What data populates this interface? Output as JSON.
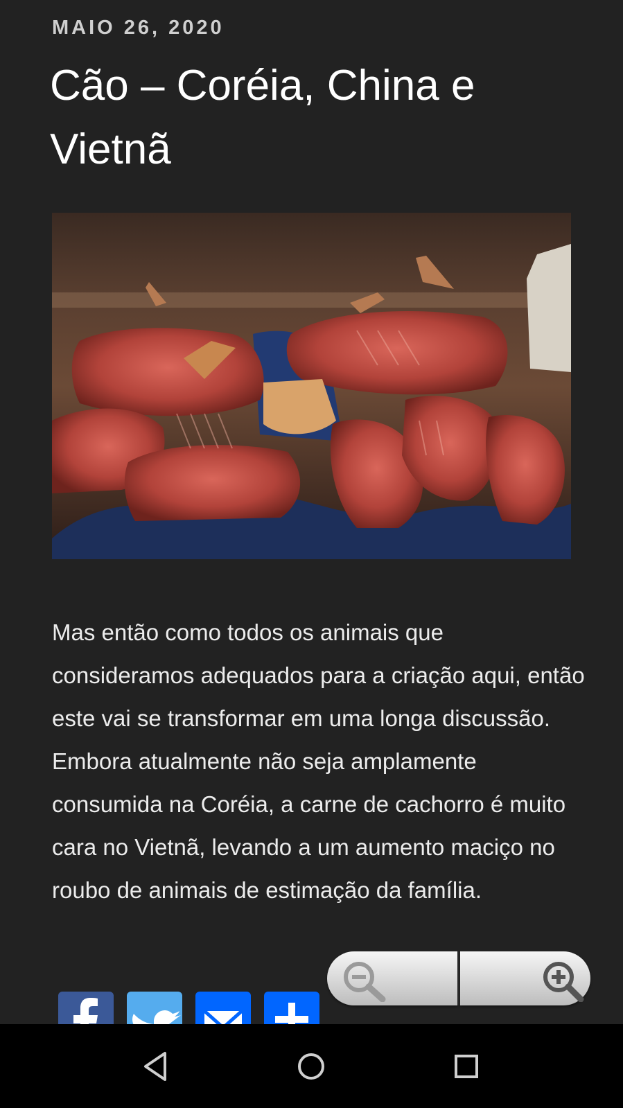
{
  "post": {
    "date": "MAIO 26, 2020",
    "title": "Cão – Coréia, China e Vietnã",
    "body": "Mas então como todos os animais que consideramos adequados para a criação aqui, então este vai se transformar em uma longa discussão. Embora atualmente não seja amplamente consumida na Coréia, a carne de cachorro é muito cara no Vietnã, levando a um aumento maciço no roubo de animais de estimação da família."
  },
  "share": [
    {
      "name": "facebook",
      "icon": "facebook-icon",
      "color": "#3b5998"
    },
    {
      "name": "twitter",
      "icon": "twitter-bird-icon",
      "color": "#55acee"
    },
    {
      "name": "email",
      "icon": "envelope-icon",
      "color": "#0166ff"
    },
    {
      "name": "share",
      "icon": "plus-icon",
      "color": "#0166ff"
    }
  ],
  "zoom": {
    "out_icon": "zoom-out-icon",
    "in_icon": "zoom-in-icon"
  },
  "nav": {
    "back_icon": "triangle-back-icon",
    "home_icon": "circle-home-icon",
    "recents_icon": "square-recents-icon"
  }
}
